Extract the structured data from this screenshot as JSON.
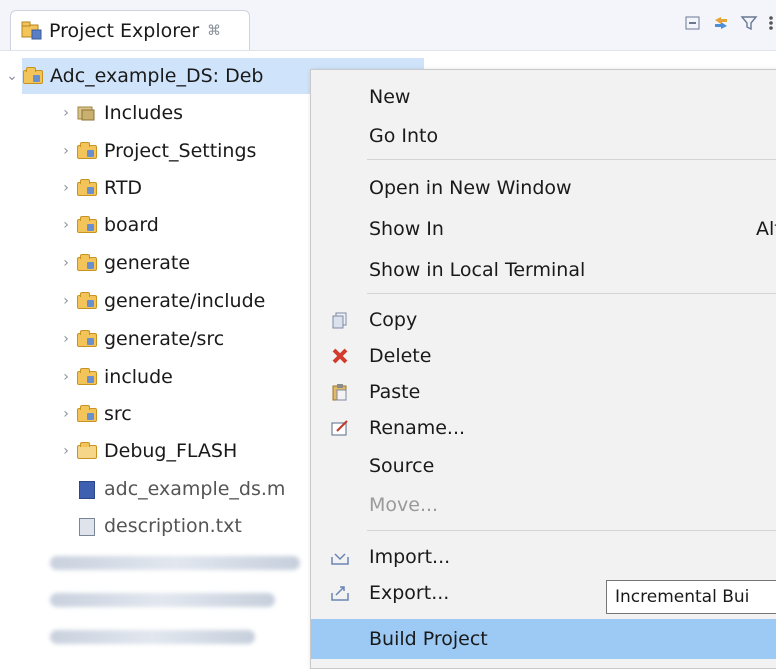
{
  "view": {
    "title": "Project Explorer",
    "close_glyph": "⌘"
  },
  "toolbar": {
    "icons": [
      "collapse-all-icon",
      "link-editor-icon",
      "filter-icon",
      "view-menu-icon"
    ]
  },
  "tree": {
    "root": "Adc_example_DS: Deb",
    "items": [
      {
        "label": "Includes",
        "icon": "includes-icon"
      },
      {
        "label": "Project_Settings",
        "icon": "folder-icon"
      },
      {
        "label": "RTD",
        "icon": "folder-icon"
      },
      {
        "label": "board",
        "icon": "folder-icon"
      },
      {
        "label": "generate",
        "icon": "folder-icon"
      },
      {
        "label": "generate/include",
        "icon": "folder-icon"
      },
      {
        "label": "generate/src",
        "icon": "folder-icon"
      },
      {
        "label": "include",
        "icon": "folder-icon"
      },
      {
        "label": "src",
        "icon": "folder-icon"
      },
      {
        "label": "Debug_FLASH",
        "icon": "folder-icon"
      }
    ],
    "files": [
      {
        "label": "adc_example_ds.m",
        "icon": "mex-file-icon"
      },
      {
        "label": "description.txt",
        "icon": "text-file-icon"
      }
    ]
  },
  "menu": {
    "items": [
      {
        "label": "New"
      },
      {
        "label": "Go Into"
      },
      {
        "label": "Open in New Window"
      },
      {
        "label": "Show In",
        "accel": "Alt+"
      },
      {
        "label": "Show in Local Terminal"
      },
      {
        "label": "Copy",
        "icon": "copy-icon"
      },
      {
        "label": "Delete",
        "icon": "delete-icon"
      },
      {
        "label": "Paste",
        "icon": "paste-icon"
      },
      {
        "label": "Rename...",
        "icon": "rename-icon"
      },
      {
        "label": "Source"
      },
      {
        "label": "Move...",
        "disabled": true
      },
      {
        "label": "Import...",
        "icon": "import-icon"
      },
      {
        "label": "Export...",
        "icon": "export-icon"
      },
      {
        "label": "Build Project",
        "highlighted": true
      }
    ]
  },
  "tooltip": {
    "text": "Incremental Bui"
  },
  "colors": {
    "selection": "#cfe3fb",
    "menu_highlight": "#9ccaf5",
    "delete": "#d33b2e"
  }
}
